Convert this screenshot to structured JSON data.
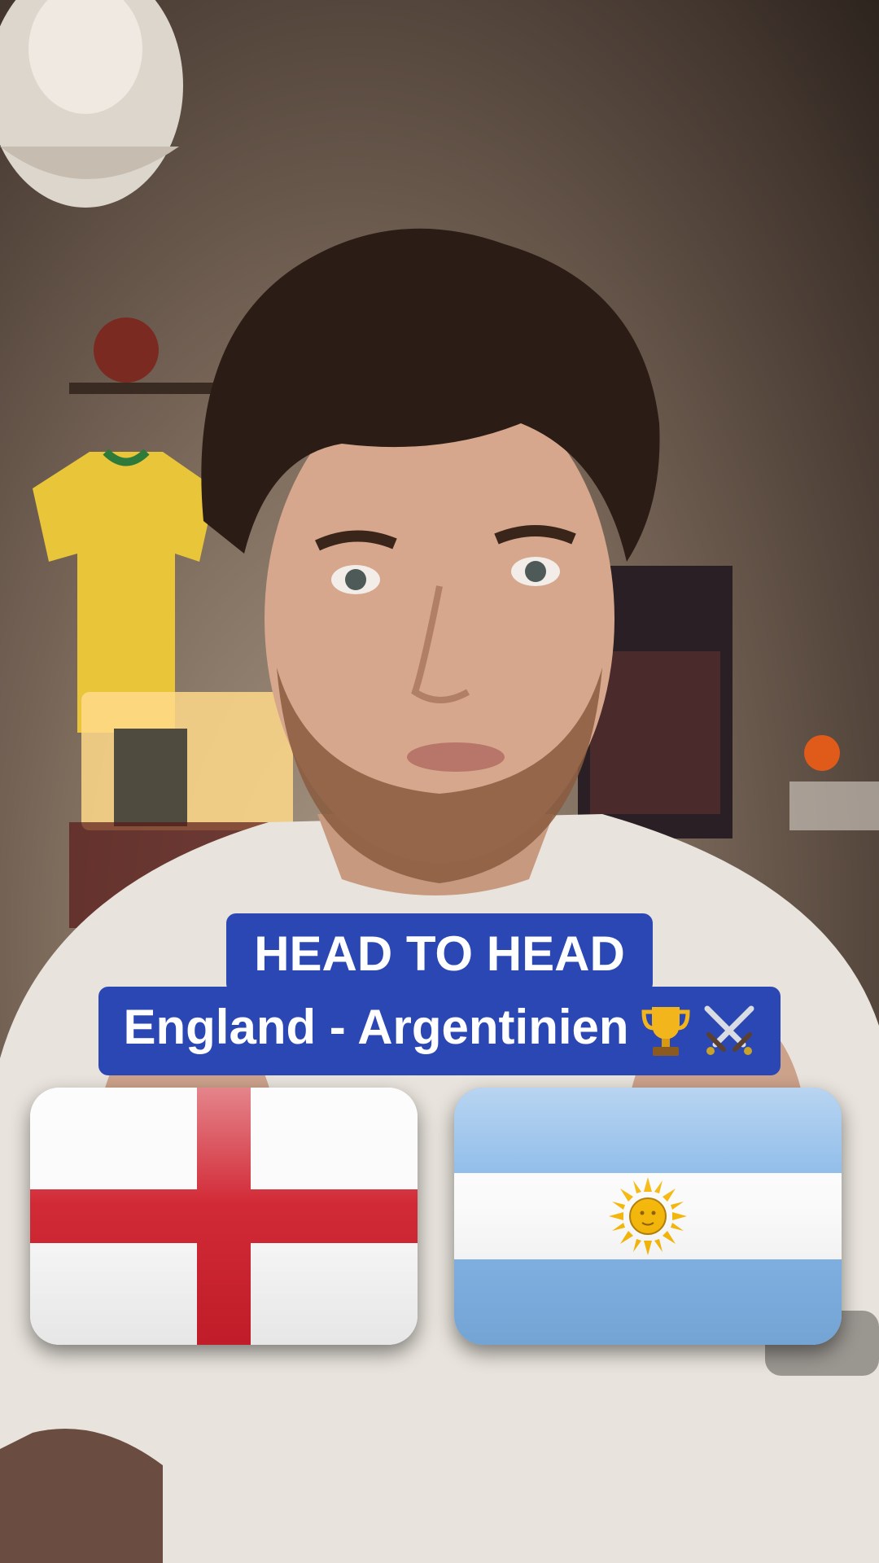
{
  "caption": {
    "line1": "HEAD TO HEAD",
    "line2": "England - Argentinien",
    "emoji_icons": [
      "trophy-icon",
      "crossed-swords-icon"
    ],
    "background_color": "#2b47b3",
    "text_color": "#ffffff"
  },
  "flags": [
    {
      "name": "England",
      "icon": "england-flag-icon",
      "colors": [
        "#ffffff",
        "#cf1f2c"
      ]
    },
    {
      "name": "Argentina",
      "icon": "argentina-flag-icon",
      "colors": [
        "#7eb2e6",
        "#ffffff",
        "#f4b400"
      ]
    }
  ]
}
